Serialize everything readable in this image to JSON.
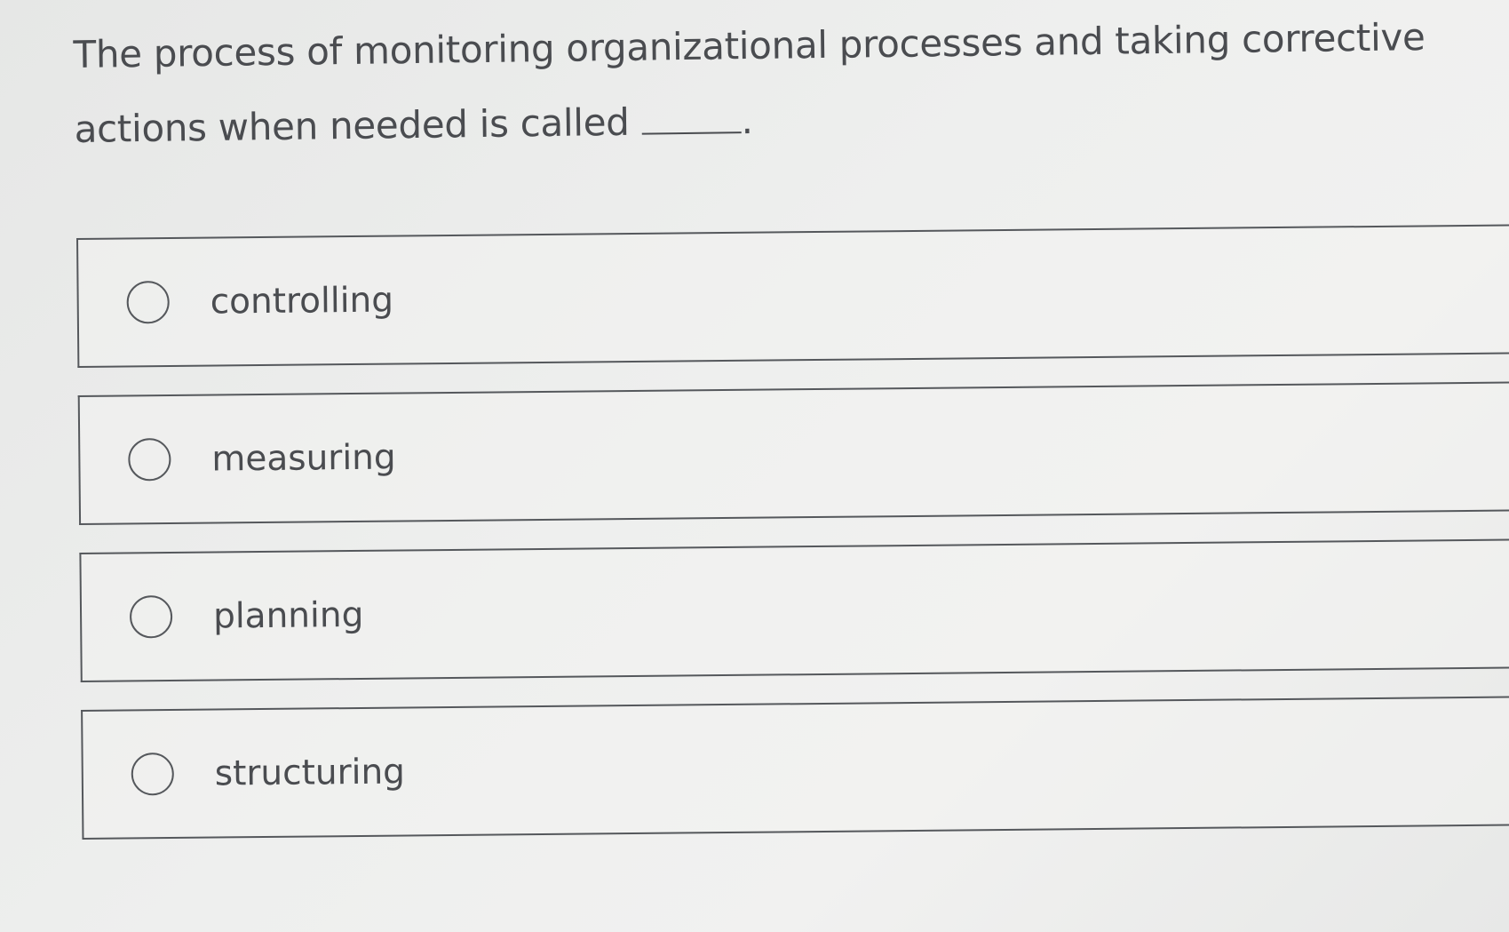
{
  "question": {
    "text": "The process of monitoring organizational processes and taking corrective actions when needed is called",
    "trailing_punctuation": "."
  },
  "options": [
    {
      "label": "controlling"
    },
    {
      "label": "measuring"
    },
    {
      "label": "planning"
    },
    {
      "label": "structuring"
    }
  ]
}
